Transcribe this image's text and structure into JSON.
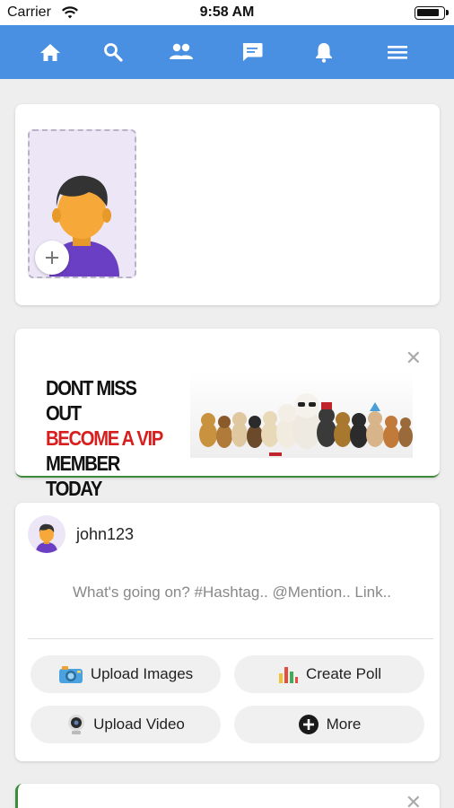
{
  "status_bar": {
    "carrier": "Carrier",
    "time": "9:58 AM"
  },
  "nav": {
    "icons": [
      "home-icon",
      "search-icon",
      "friends-icon",
      "messages-icon",
      "notifications-icon",
      "menu-icon"
    ]
  },
  "ad": {
    "line1": "DONT MISS OUT",
    "line2": "BECOME A VIP",
    "line3": "MEMBER TODAY",
    "close": "✕",
    "accent_color": "#d81f1f"
  },
  "composer": {
    "username": "john123",
    "placeholder": "What's going on? #Hashtag.. @Mention.. Link..",
    "actions": {
      "upload_images": "Upload Images",
      "create_poll": "Create Poll",
      "upload_video": "Upload Video",
      "more": "More"
    }
  },
  "colors": {
    "nav_bg": "#4a90e2",
    "ad_border": "#3d8b3d"
  }
}
